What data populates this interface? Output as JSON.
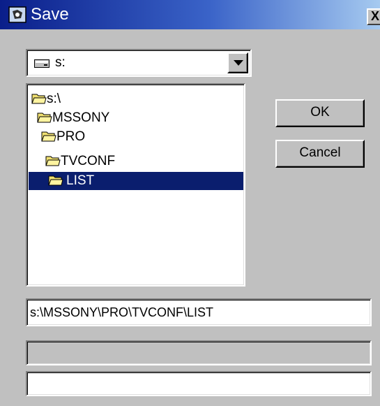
{
  "window": {
    "title": "Save",
    "close_label": "X"
  },
  "drive_select": {
    "value": "s:",
    "icon": "drive-icon"
  },
  "folders": [
    {
      "label": "s:\\",
      "icon": "open-folder-icon",
      "selected": false
    },
    {
      "label": "MSSONY",
      "icon": "open-folder-icon",
      "selected": false
    },
    {
      "label": "PRO",
      "icon": "open-folder-icon",
      "selected": false
    },
    {
      "label": "TVCONF",
      "icon": "open-folder-icon",
      "selected": false
    },
    {
      "label": "LIST",
      "icon": "open-folder-icon",
      "selected": true
    }
  ],
  "buttons": {
    "ok": "OK",
    "cancel": "Cancel"
  },
  "path_field": {
    "value": "s:\\MSSONY\\PRO\\TVCONF\\LIST"
  },
  "colors": {
    "selection": "#0a1e6e",
    "titlebar_start": "#0a1e8a",
    "titlebar_end": "#a6caf0",
    "face": "#c0c0c0"
  }
}
